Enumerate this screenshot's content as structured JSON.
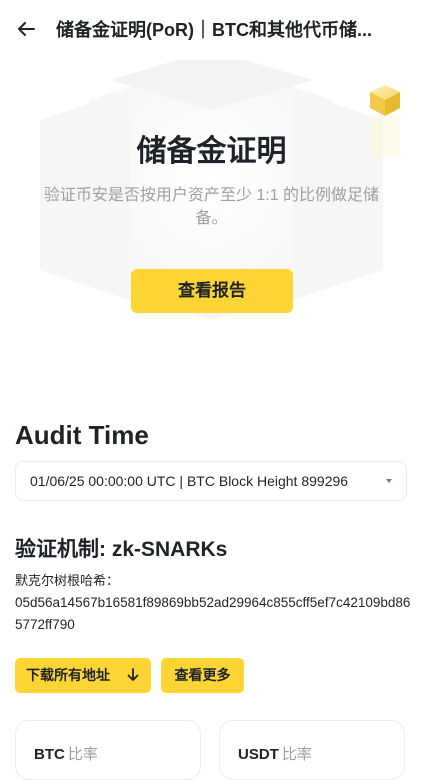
{
  "header": {
    "title": "储备金证明(PoR)｜BTC和其他代币储..."
  },
  "hero": {
    "title": "储备金证明",
    "description": "验证币安是否按用户资产至少 1:1 的比例做足储备。",
    "report_button": "查看报告"
  },
  "audit": {
    "title": "Audit Time",
    "selected_value": "01/06/25 00:00:00 UTC | BTC Block Height 899296"
  },
  "mechanism": {
    "title": "验证机制: zk-SNARKs",
    "hash_label": "默克尔树根哈希：",
    "hash_value": "05d56a14567b16581f89869bb52ad29964c855cff5ef7c42109bd865772ff790",
    "download_button": "下载所有地址",
    "more_button": "查看更多"
  },
  "cards": [
    {
      "coin": "BTC",
      "label": "比率"
    },
    {
      "coin": "USDT",
      "label": "比率"
    }
  ],
  "colors": {
    "accent": "#fcd535",
    "text_primary": "#1e2329",
    "text_muted": "#9aa0a8",
    "border": "#eaecef"
  },
  "icons": {
    "back": "arrow-left-icon",
    "select": "caret-down-icon",
    "download": "arrow-down-icon",
    "decoration": "gold-cube-icon"
  }
}
